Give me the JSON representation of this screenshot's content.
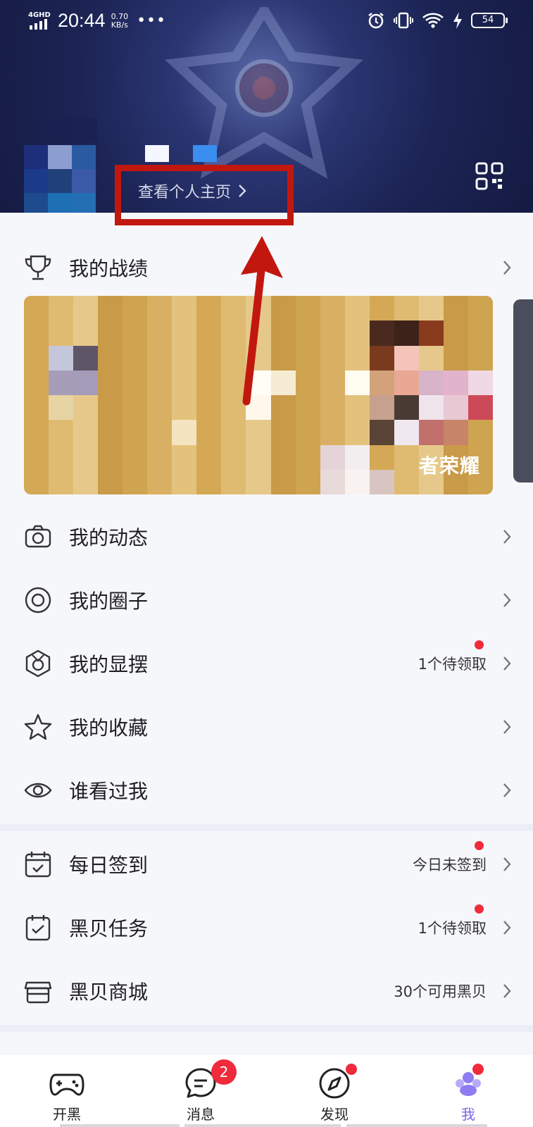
{
  "status_bar": {
    "network": "4GHD",
    "time": "20:44",
    "speed_value": "0.70",
    "speed_unit": "KB/s",
    "more": "•••",
    "battery": "54"
  },
  "header": {
    "profile_link": "查看个人主页",
    "qr_icon": "qr-code-icon"
  },
  "menu_group_1": [
    {
      "label": "我的战绩",
      "icon": "trophy-icon"
    }
  ],
  "banner": {
    "text": "者荣耀"
  },
  "menu_group_2": [
    {
      "label": "我的动态",
      "icon": "camera-icon",
      "value": ""
    },
    {
      "label": "我的圈子",
      "icon": "circle-icon",
      "value": ""
    },
    {
      "label": "我的显摆",
      "icon": "badge-icon",
      "value": "1个待领取"
    },
    {
      "label": "我的收藏",
      "icon": "star-icon",
      "value": ""
    },
    {
      "label": "谁看过我",
      "icon": "eye-icon",
      "value": ""
    }
  ],
  "menu_group_3": [
    {
      "label": "每日签到",
      "icon": "calendar-check-icon",
      "value": "今日未签到"
    },
    {
      "label": "黑贝任务",
      "icon": "task-icon",
      "value": "1个待领取"
    },
    {
      "label": "黑贝商城",
      "icon": "store-icon",
      "value": "30个可用黑贝"
    }
  ],
  "tabbar": {
    "tabs": [
      {
        "label": "开黑",
        "icon": "gamepad-icon"
      },
      {
        "label": "消息",
        "icon": "message-icon",
        "badge": "2"
      },
      {
        "label": "发现",
        "icon": "compass-icon"
      },
      {
        "label": "我",
        "icon": "me-icon"
      }
    ]
  },
  "colors": {
    "accent_red": "#ef2b3c",
    "highlight": "#c2170f",
    "header_bg": "#1c2454"
  }
}
